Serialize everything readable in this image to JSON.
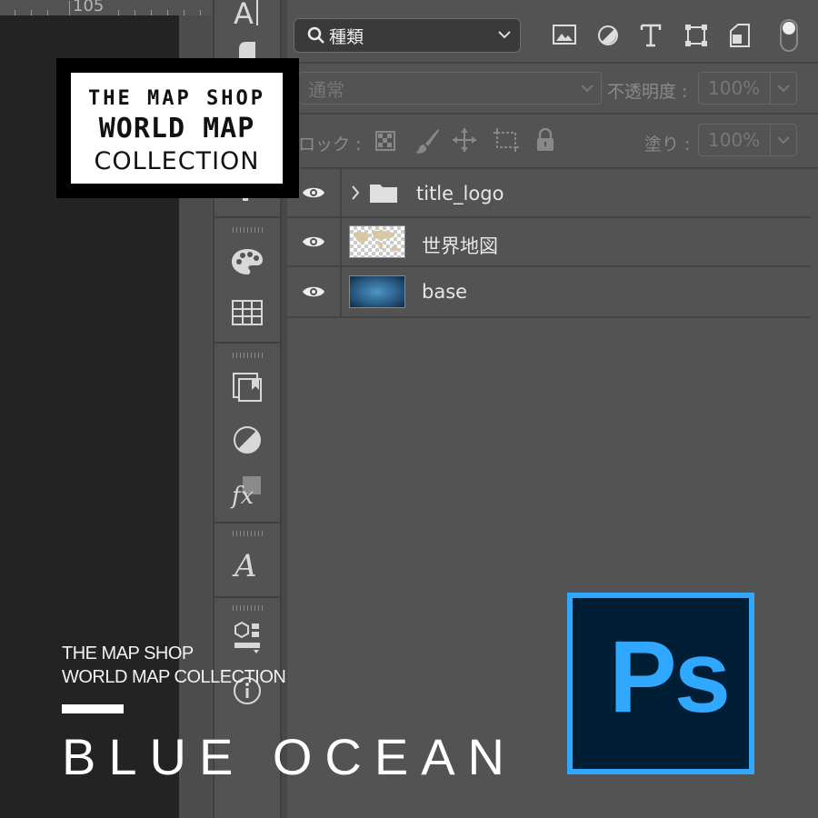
{
  "ruler": {
    "number": "105"
  },
  "layers_panel": {
    "filter": {
      "label": "種類"
    },
    "blend_mode": {
      "value": "通常"
    },
    "opacity": {
      "label": "不透明度 :",
      "value": "100%"
    },
    "lock": {
      "label": "ロック :"
    },
    "fill": {
      "label": "塗り :",
      "value": "100%"
    },
    "layers": [
      {
        "name": "title_logo",
        "type": "group",
        "visible": true
      },
      {
        "name": "世界地図",
        "type": "pixel",
        "visible": true
      },
      {
        "name": "base",
        "type": "pixel",
        "visible": true
      }
    ]
  },
  "logo": {
    "line1": "THE MAP SHOP",
    "line2": "WORLD MAP",
    "line3": "COLLECTION"
  },
  "caption": {
    "line1": "THE MAP SHOP",
    "line2": "WORLD MAP COLLECTION",
    "headline": "BLUE OCEAN"
  },
  "ps_logo": {
    "text": "Ps"
  },
  "colors": {
    "panel_bg": "#535353",
    "canvas_bg": "#232323",
    "ps_blue": "#31a8ff",
    "ps_navy": "#001e36"
  },
  "icons": {
    "toolbar": [
      "type-tool-icon",
      "paragraph-icon",
      "palette-icon",
      "grid-icon",
      "libraries-icon",
      "adjustments-icon",
      "styles-fx-icon",
      "glyph-icon",
      "3d-icon",
      "info-icon"
    ],
    "filters": [
      "image-filter-icon",
      "adjustment-filter-icon",
      "type-filter-icon",
      "shape-filter-icon",
      "smart-object-filter-icon",
      "filter-toggle-icon"
    ],
    "locks": [
      "lock-transparent-icon",
      "lock-image-icon",
      "lock-position-icon",
      "lock-artboard-icon",
      "lock-all-icon"
    ]
  }
}
